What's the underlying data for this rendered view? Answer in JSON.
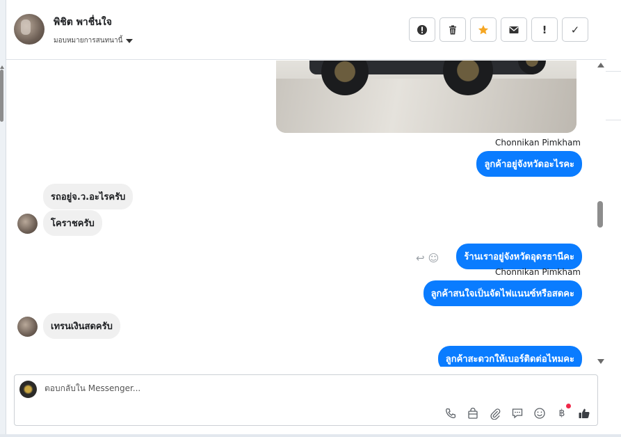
{
  "header": {
    "contact_name": "พิชิต พาชื่นใจ",
    "assign_label": "มอบหมายการสนทนานี้",
    "tools": [
      {
        "icon": "alert-circle-icon",
        "glyph": "!"
      },
      {
        "icon": "trash-icon"
      },
      {
        "icon": "star-icon",
        "color": "#f5a623"
      },
      {
        "icon": "envelope-icon"
      },
      {
        "icon": "exclamation-icon",
        "glyph": "!"
      },
      {
        "icon": "check-icon",
        "glyph": "✓"
      }
    ]
  },
  "thread": {
    "messages": [
      {
        "from": "page",
        "sender": "Chonnikan Pimkham",
        "text": "ลูกค้าอยู่จังหวัดอะไรคะ"
      },
      {
        "from": "customer",
        "text": "รถอยู่จ.ว.อะไรครับ"
      },
      {
        "from": "customer",
        "text": "โคราชครับ"
      },
      {
        "from": "page",
        "text": "ร้านเราอยู่จังหวัดอุดรธานีคะ"
      },
      {
        "from": "page",
        "sender": "Chonnikan Pimkham",
        "text": "ลูกค้าสนใจเป็นจัดไฟแนนซ์หรือสดคะ"
      },
      {
        "from": "customer",
        "text": "เทรนเงินสดครับ"
      },
      {
        "from": "page",
        "text": "ลูกค้าสะดวกให้เบอร์ติดต่อไหมคะ"
      }
    ]
  },
  "composer": {
    "placeholder": "ตอบกลับใน Messenger...",
    "icons": [
      "phone-icon",
      "shopping-bag-icon",
      "paperclip-icon",
      "saved-reply-icon",
      "emoji-icon",
      "baht-icon",
      "thumbs-up-icon"
    ],
    "accent_color": "#0a7cff"
  }
}
